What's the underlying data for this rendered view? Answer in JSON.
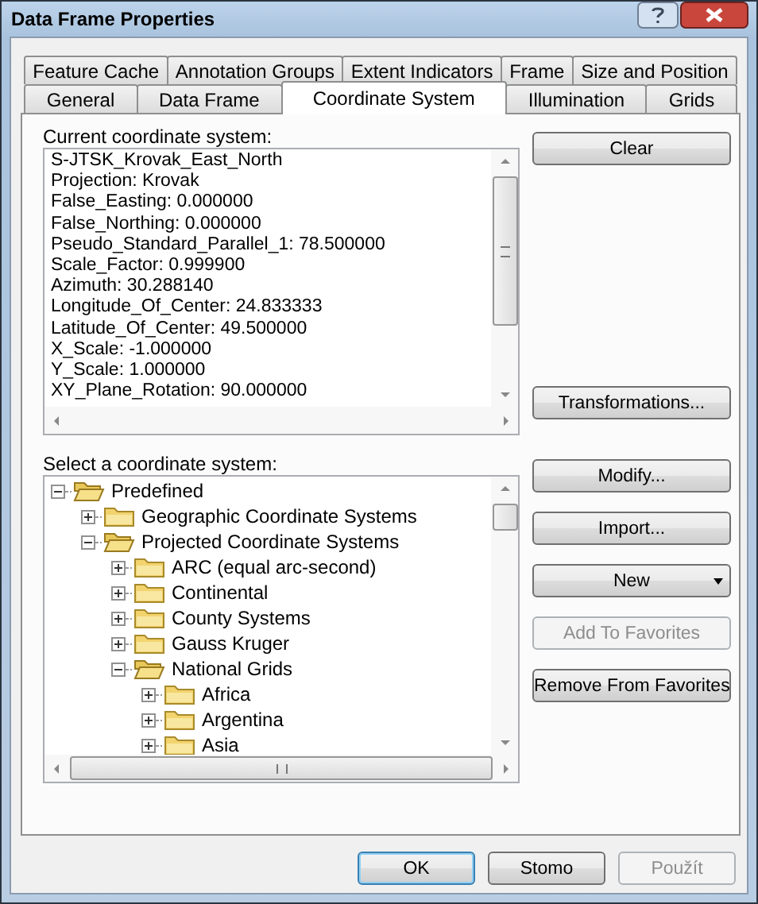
{
  "window": {
    "title": "Data Frame Properties"
  },
  "tab_rows": [
    {
      "tabs": [
        {
          "label": "Feature Cache",
          "selected": false
        },
        {
          "label": "Annotation Groups",
          "selected": false
        },
        {
          "label": "Extent Indicators",
          "selected": false
        },
        {
          "label": "Frame",
          "selected": false
        },
        {
          "label": "Size and Position",
          "selected": false
        }
      ]
    },
    {
      "tabs": [
        {
          "label": "General",
          "selected": false
        },
        {
          "label": "Data Frame",
          "selected": false
        },
        {
          "label": "Coordinate System",
          "selected": true
        },
        {
          "label": "Illumination",
          "selected": false
        },
        {
          "label": "Grids",
          "selected": false
        }
      ]
    }
  ],
  "current": {
    "label": "Current coordinate system:",
    "lines": [
      "S-JTSK_Krovak_East_North",
      "Projection: Krovak",
      "False_Easting: 0.000000",
      "False_Northing: 0.000000",
      "Pseudo_Standard_Parallel_1: 78.500000",
      "Scale_Factor: 0.999900",
      "Azimuth: 30.288140",
      "Longitude_Of_Center: 24.833333",
      "Latitude_Of_Center: 49.500000",
      "X_Scale: -1.000000",
      "Y_Scale: 1.000000",
      "XY_Plane_Rotation: 90.000000"
    ]
  },
  "select": {
    "label": "Select a coordinate system:",
    "tree": [
      {
        "label": "Predefined",
        "expanded": true,
        "children": [
          {
            "label": "Geographic Coordinate Systems",
            "expanded": false
          },
          {
            "label": "Projected Coordinate Systems",
            "expanded": true,
            "children": [
              {
                "label": "ARC (equal arc-second)",
                "expanded": false
              },
              {
                "label": "Continental",
                "expanded": false
              },
              {
                "label": "County Systems",
                "expanded": false
              },
              {
                "label": "Gauss Kruger",
                "expanded": false
              },
              {
                "label": "National Grids",
                "expanded": true,
                "children": [
                  {
                    "label": "Africa",
                    "expanded": false
                  },
                  {
                    "label": "Argentina",
                    "expanded": false
                  },
                  {
                    "label": "Asia",
                    "expanded": false
                  }
                ]
              }
            ]
          }
        ]
      }
    ]
  },
  "top_buttons": [
    {
      "label": "Clear",
      "disabled": false
    },
    {
      "label": "Transformations...",
      "disabled": false
    }
  ],
  "side_buttons": [
    {
      "label": "Modify...",
      "disabled": false,
      "has_menu": false
    },
    {
      "label": "Import...",
      "disabled": false,
      "has_menu": false
    },
    {
      "label": "New",
      "disabled": false,
      "has_menu": true
    },
    {
      "label": "Add To Favorites",
      "disabled": true,
      "has_menu": false
    },
    {
      "label": "Remove From Favorites",
      "disabled": false,
      "has_menu": false
    }
  ],
  "footer_buttons": [
    {
      "label": "OK",
      "default": true,
      "disabled": false
    },
    {
      "label": "Stomo",
      "default": false,
      "disabled": false
    },
    {
      "label": "Použít",
      "default": false,
      "disabled": true
    }
  ]
}
